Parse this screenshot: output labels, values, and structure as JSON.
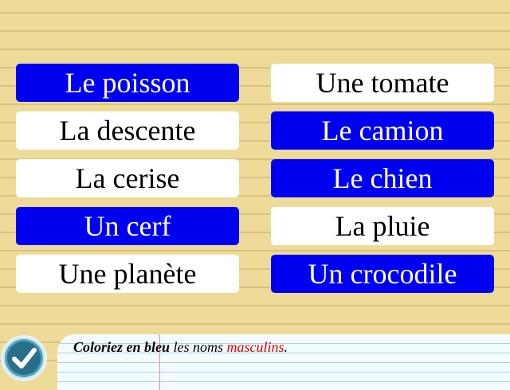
{
  "tiles": [
    {
      "label": "Le poisson",
      "state": "blue"
    },
    {
      "label": "Une tomate",
      "state": "white"
    },
    {
      "label": "La descente",
      "state": "white"
    },
    {
      "label": "Le camion",
      "state": "blue"
    },
    {
      "label": "La cerise",
      "state": "white"
    },
    {
      "label": "Le chien",
      "state": "blue"
    },
    {
      "label": "Un cerf",
      "state": "blue"
    },
    {
      "label": "La pluie",
      "state": "white"
    },
    {
      "label": "Une planète",
      "state": "white"
    },
    {
      "label": "Un crocodile",
      "state": "blue"
    }
  ],
  "instruction": {
    "part1": "Coloriez en bleu",
    "part2": " les noms ",
    "part3": "masculins",
    "part4": "."
  },
  "check_button": {
    "icon": "checkmark-icon"
  },
  "colors": {
    "selected_blue": "#0000f0",
    "highlight_red": "#e00000",
    "paper_yellow": "#eedb9a"
  }
}
